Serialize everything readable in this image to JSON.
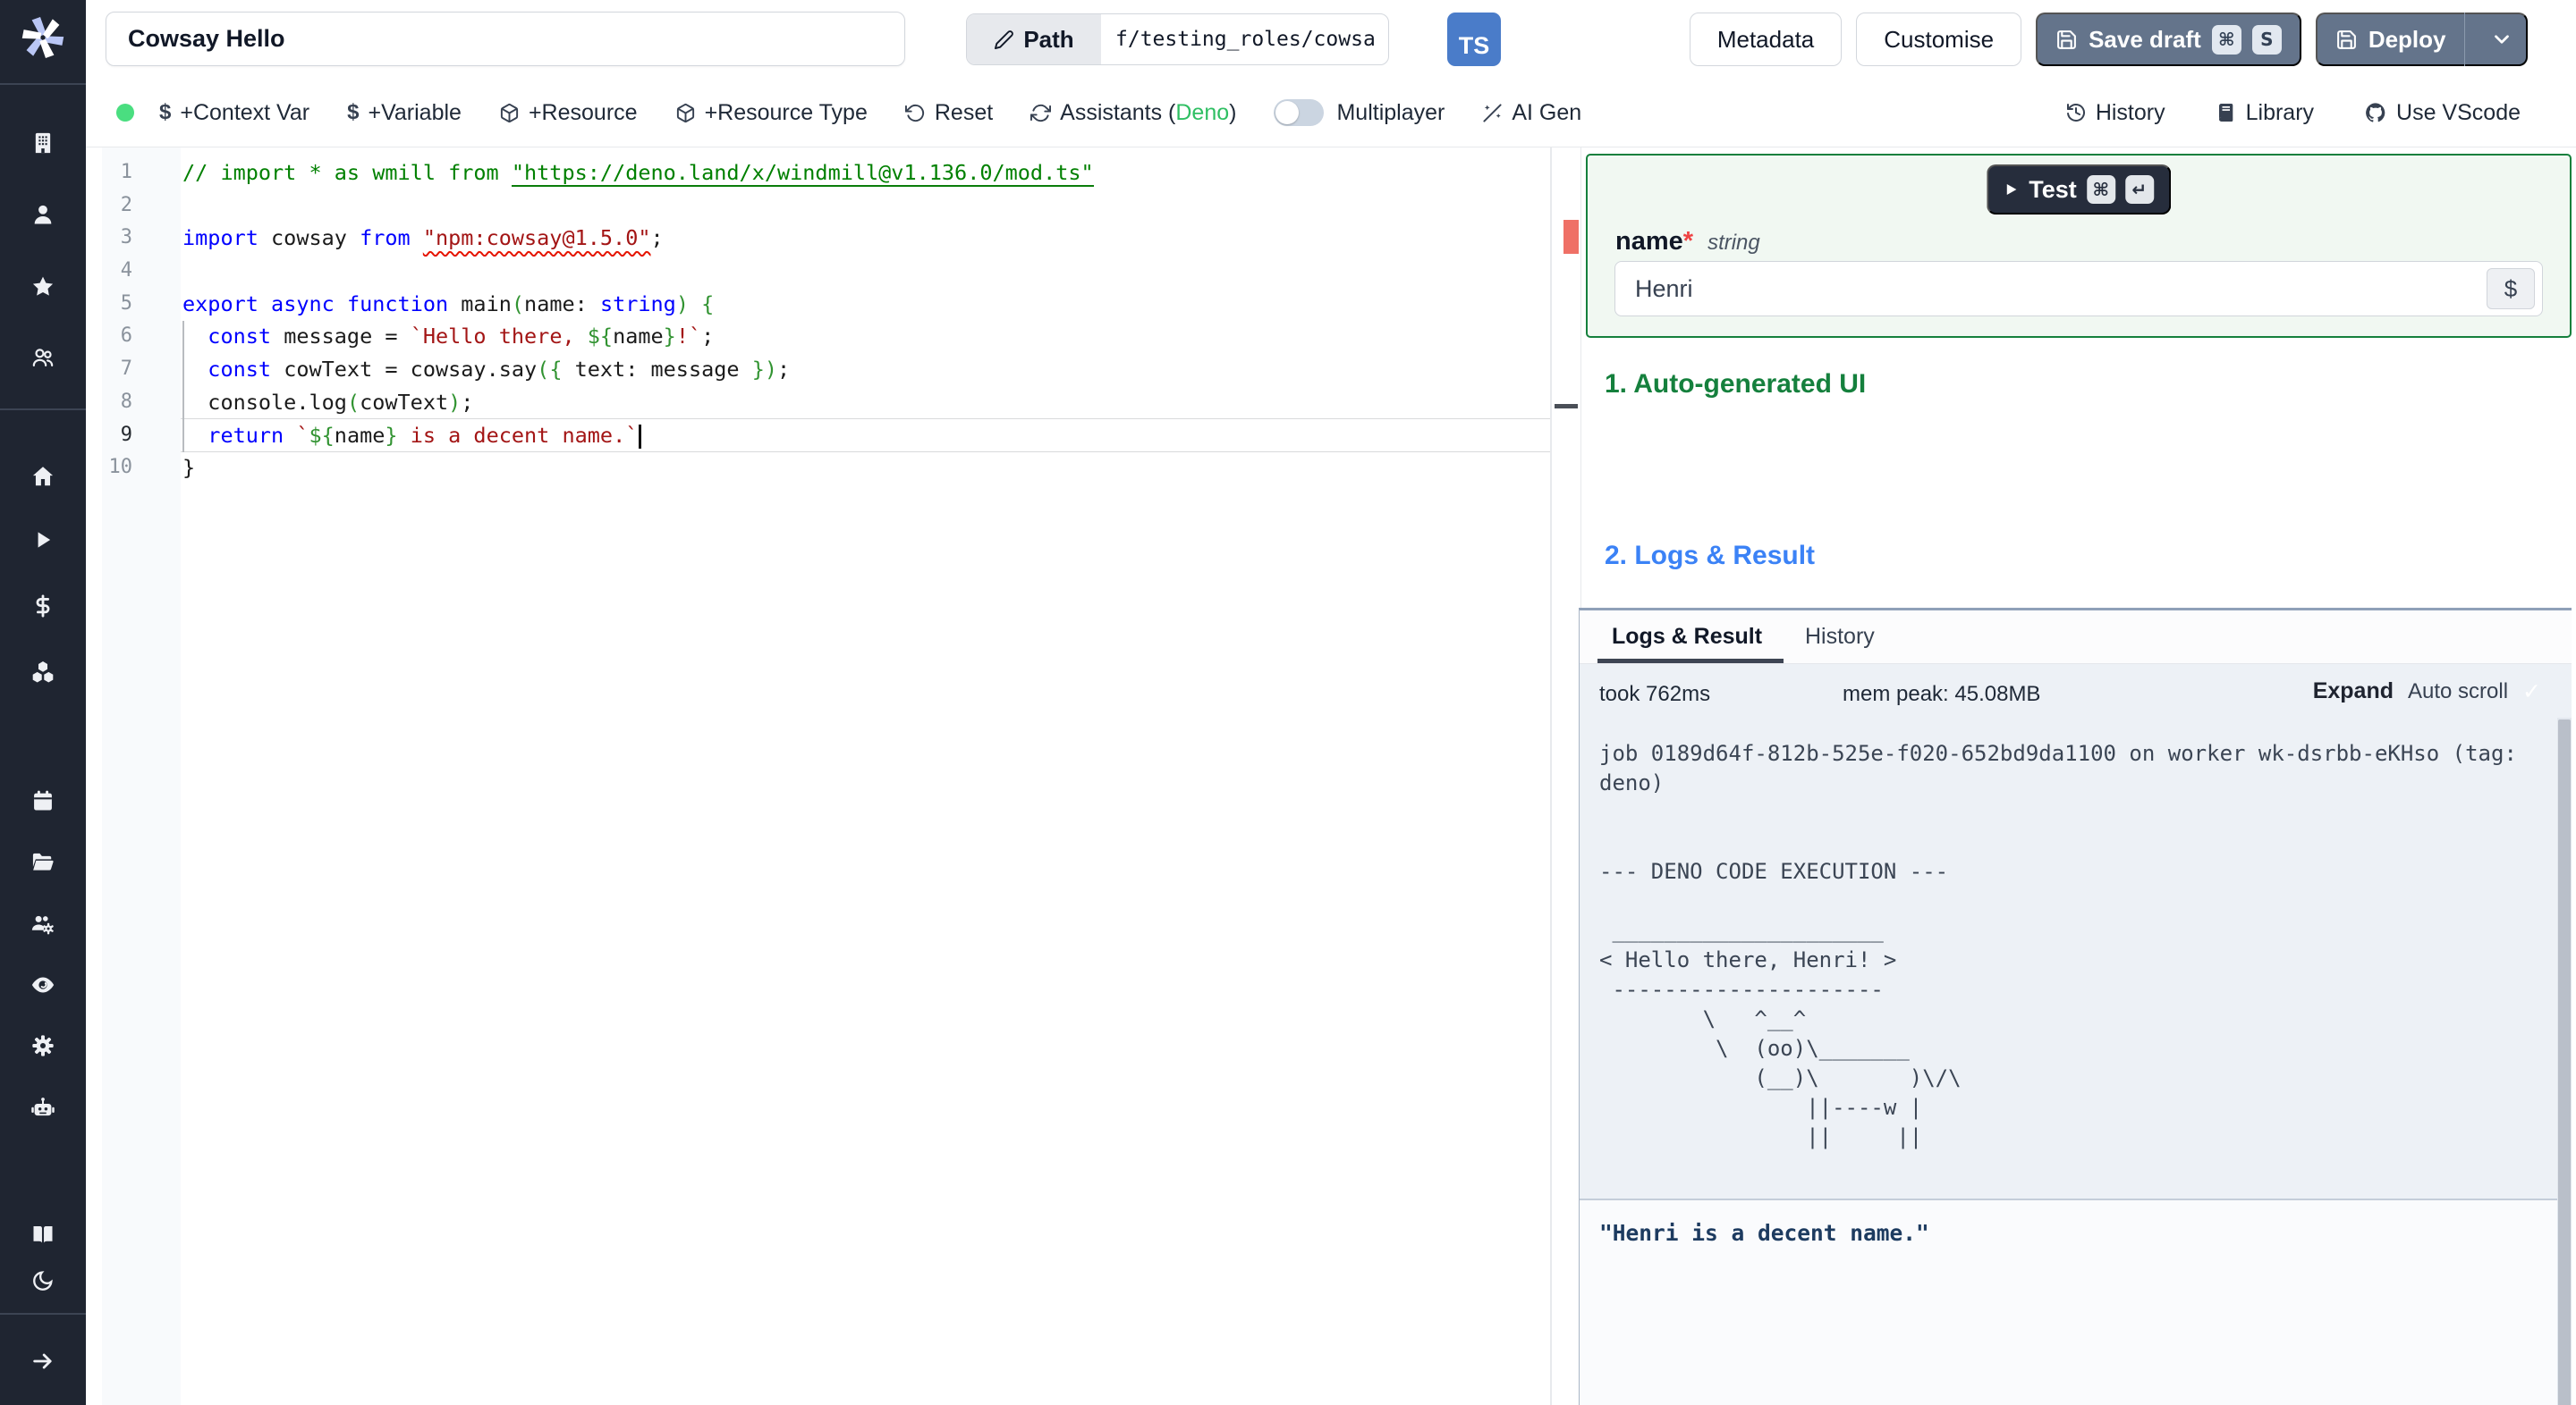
{
  "sidebar": {
    "icons": [
      "windmill-logo",
      "building-icon",
      "user-icon",
      "star-icon",
      "users-icon",
      "home-icon",
      "play-icon",
      "dollar-icon",
      "cubes-icon",
      "calendar-icon",
      "folder-open-icon",
      "team-gear-icon",
      "eye-icon",
      "gear-icon",
      "robot-icon",
      "book-open-icon",
      "moon-icon",
      "arrow-right-icon"
    ]
  },
  "topbar": {
    "title_value": "Cowsay Hello",
    "path_label": "Path",
    "path_value": "f/testing_roles/cowsa",
    "lang_badge": "TS",
    "metadata": "Metadata",
    "customise": "Customise",
    "save_draft": "Save draft",
    "kbd_cmd": "⌘",
    "kbd_s": "S",
    "deploy": "Deploy"
  },
  "toolbar": {
    "dollar": "$",
    "context_var": "+Context Var",
    "variable": "+Variable",
    "resource": "+Resource",
    "resource_type": "+Resource Type",
    "reset": "Reset",
    "assistants_prefix": "Assistants (",
    "assistants_lang": "Deno",
    "assistants_suffix": ")",
    "multiplayer": "Multiplayer",
    "ai_gen": "AI Gen",
    "history": "History",
    "library": "Library",
    "use_vscode": "Use VScode"
  },
  "editor": {
    "lines": [
      {
        "n": "1",
        "tokens": [
          {
            "t": "// import * as wmill from ",
            "c": "tok-comment"
          },
          {
            "t": "\"https://deno.land/x/windmill@v1.136.0/mod.ts\"",
            "c": "tok-comment tok-link"
          }
        ]
      },
      {
        "n": "2",
        "tokens": []
      },
      {
        "n": "3",
        "tokens": [
          {
            "t": "import",
            "c": "tok-kw"
          },
          {
            "t": " cowsay ",
            "c": "tok-plain"
          },
          {
            "t": "from",
            "c": "tok-kw"
          },
          {
            "t": " ",
            "c": "tok-plain"
          },
          {
            "t": "\"npm:cowsay@1.5.0\"",
            "c": "tok-str tok-squiggle"
          },
          {
            "t": ";",
            "c": "tok-plain"
          }
        ]
      },
      {
        "n": "4",
        "tokens": []
      },
      {
        "n": "5",
        "tokens": [
          {
            "t": "export",
            "c": "tok-kw"
          },
          {
            "t": " ",
            "c": "tok-plain"
          },
          {
            "t": "async",
            "c": "tok-kw"
          },
          {
            "t": " ",
            "c": "tok-plain"
          },
          {
            "t": "function",
            "c": "tok-kw"
          },
          {
            "t": " main",
            "c": "tok-plain"
          },
          {
            "t": "(",
            "c": "tok-bracket"
          },
          {
            "t": "name: ",
            "c": "tok-plain"
          },
          {
            "t": "string",
            "c": "tok-kw"
          },
          {
            "t": ")",
            "c": "tok-bracket"
          },
          {
            "t": " ",
            "c": "tok-plain"
          },
          {
            "t": "{",
            "c": "tok-bracket"
          }
        ]
      },
      {
        "n": "6",
        "tokens": [
          {
            "t": "  ",
            "c": "tok-plain"
          },
          {
            "t": "const",
            "c": "tok-kw"
          },
          {
            "t": " message = ",
            "c": "tok-plain"
          },
          {
            "t": "`Hello there, ",
            "c": "tok-str"
          },
          {
            "t": "${",
            "c": "tok-bracket"
          },
          {
            "t": "name",
            "c": "tok-plain"
          },
          {
            "t": "}",
            "c": "tok-bracket"
          },
          {
            "t": "!`",
            "c": "tok-str"
          },
          {
            "t": ";",
            "c": "tok-plain"
          }
        ]
      },
      {
        "n": "7",
        "tokens": [
          {
            "t": "  ",
            "c": "tok-plain"
          },
          {
            "t": "const",
            "c": "tok-kw"
          },
          {
            "t": " cowText = cowsay.say",
            "c": "tok-plain"
          },
          {
            "t": "({",
            "c": "tok-bracket"
          },
          {
            "t": " text: message ",
            "c": "tok-plain"
          },
          {
            "t": "})",
            "c": "tok-bracket"
          },
          {
            "t": ";",
            "c": "tok-plain"
          }
        ]
      },
      {
        "n": "8",
        "tokens": [
          {
            "t": "  console.log",
            "c": "tok-plain"
          },
          {
            "t": "(",
            "c": "tok-bracket"
          },
          {
            "t": "cowText",
            "c": "tok-plain"
          },
          {
            "t": ")",
            "c": "tok-bracket"
          },
          {
            "t": ";",
            "c": "tok-plain"
          }
        ]
      },
      {
        "n": "9",
        "current": true,
        "cursor": true,
        "tokens": [
          {
            "t": "  ",
            "c": "tok-plain"
          },
          {
            "t": "return",
            "c": "tok-kw"
          },
          {
            "t": " ",
            "c": "tok-plain"
          },
          {
            "t": "`",
            "c": "tok-str"
          },
          {
            "t": "${",
            "c": "tok-bracket"
          },
          {
            "t": "name",
            "c": "tok-plain"
          },
          {
            "t": "}",
            "c": "tok-bracket"
          },
          {
            "t": " is a decent name.`",
            "c": "tok-str"
          }
        ]
      },
      {
        "n": "10",
        "tokens": [
          {
            "t": "}",
            "c": "tok-plain"
          }
        ]
      }
    ]
  },
  "form": {
    "test_label": "Test",
    "kbd_cmd": "⌘",
    "kbd_enter": "↵",
    "name_label": "name",
    "required_mark": "*",
    "type_label": "string",
    "value": "Henri",
    "dollar": "$"
  },
  "sections": {
    "auto_ui": "1. Auto-generated UI",
    "logs_result": "2. Logs & Result"
  },
  "logs": {
    "tab_logs": "Logs & Result",
    "tab_history": "History",
    "took": "took 762ms",
    "mem": "mem peak: 45.08MB",
    "expand": "Expand",
    "autoscroll": "Auto scroll",
    "check": "✓",
    "log_text": "job 0189d64f-812b-525e-f020-652bd9da1100 on worker wk-dsrbb-eKHso (tag:\ndeno)\n\n\n--- DENO CODE EXECUTION ---\n\n _____________________\n< Hello there, Henri! >\n ---------------------\n        \\   ^__^\n         \\  (oo)\\_______\n            (__)\\       )\\/\\\n                ||----w |\n                ||     ||",
    "result": "\"Henri is a decent name.\""
  },
  "colors": {
    "accent_green": "#15803d",
    "deno_green": "#2fbf63",
    "heading_blue": "#3b82f6",
    "error_red": "#e51400",
    "brand_blue": "#4a7cc9",
    "slate_button": "#64748b",
    "status_dot_green": "#4ade80"
  }
}
